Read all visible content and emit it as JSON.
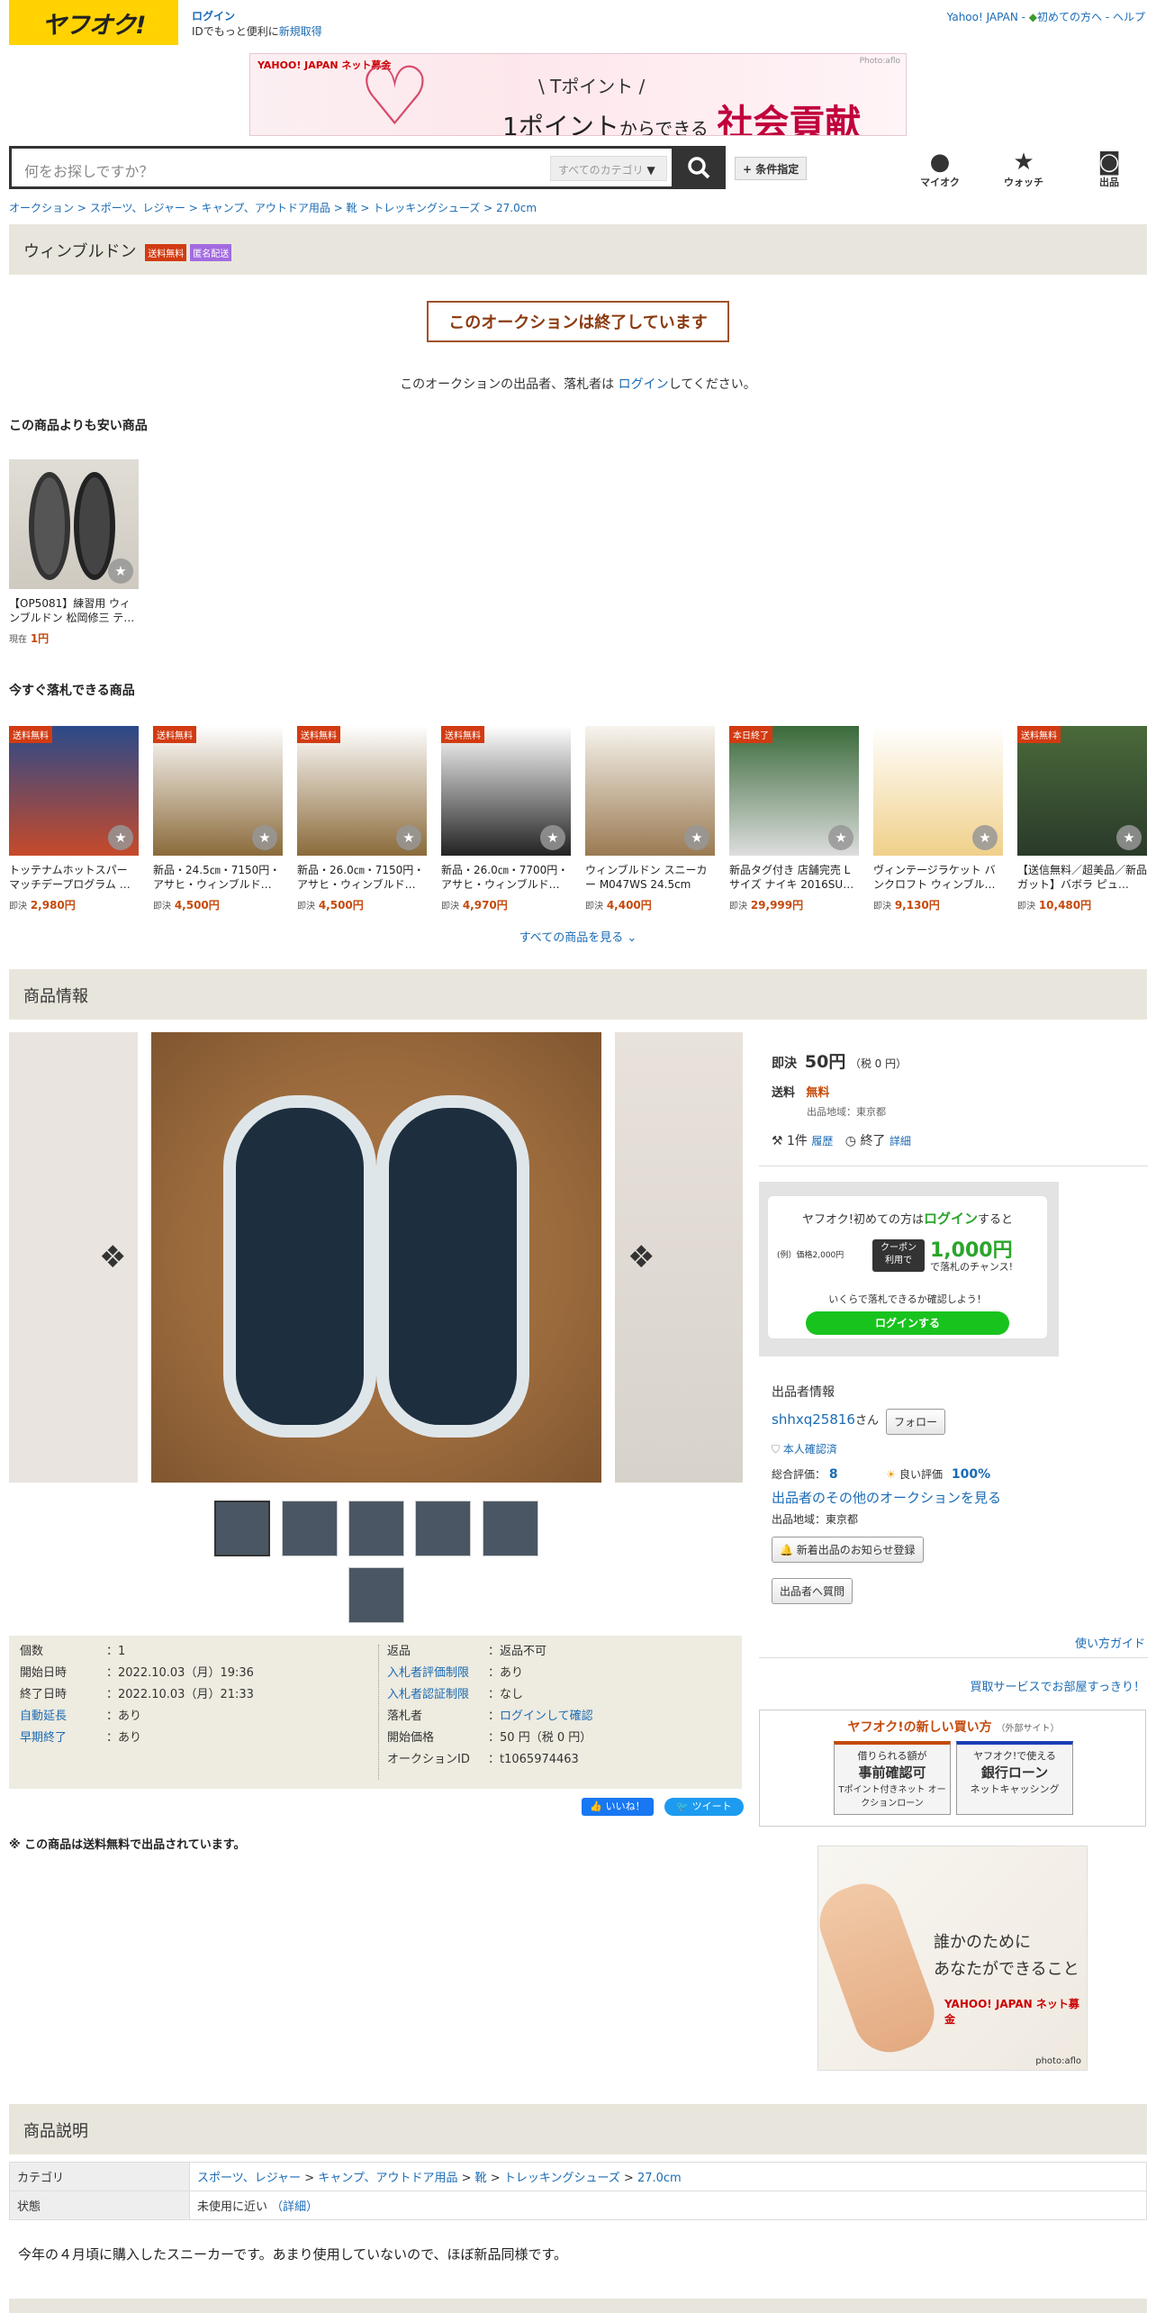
{
  "header": {
    "logo": "ヤフオク!",
    "login": "ログイン",
    "login_sub_prefix": "IDでもっと便利に",
    "register": "新規取得",
    "yahoo_japan": "Yahoo! JAPAN",
    "first_time": "初めての方へ",
    "help": "ヘルプ"
  },
  "banner": {
    "brand": "YAHOO! JAPAN ネット募金",
    "photo": "Photo:aflo",
    "line1": "\\ Tポイント /",
    "line2_a": "1ポイント",
    "line2_b": "からできる",
    "line2_c": "社会貢献"
  },
  "search": {
    "placeholder": "何をお探しですか？",
    "category": "すべてのカテゴリ",
    "conditions": "+ 条件指定"
  },
  "header_icons": {
    "myauc": "マイオク",
    "watch": "ウォッチ",
    "sell": "出品"
  },
  "breadcrumb": [
    "オークション",
    "スポーツ、レジャー",
    "キャンプ、アウトドア用品",
    "靴",
    "トレッキングシューズ",
    "27.0cm"
  ],
  "title": {
    "name": "ウィンブルドン",
    "badge1": "送料無料",
    "badge2": "匿名配送",
    "badge1_color": "#d23b12",
    "badge2_color": "#a36be0"
  },
  "ended": {
    "text": "このオークションは終了しています",
    "note_prefix": "このオークションの出品者、落札者は",
    "note_link": "ログイン",
    "note_suffix": "してください。"
  },
  "cheaper": {
    "heading": "この商品よりも安い商品",
    "items": [
      {
        "title": "【OP5081】練習用 ウィンブルドン 松岡修三 テ…",
        "price_label": "現在",
        "price": "1円"
      }
    ]
  },
  "buynow": {
    "heading": "今すぐ落札できる商品",
    "items": [
      {
        "tag": "送料無料",
        "title": "トッテナムホットスパー マッチデープログラム …",
        "price": "2,980円"
      },
      {
        "tag": "送料無料",
        "title": "新品・24.5㎝・7150円・アサヒ・ウィンブルド…",
        "price": "4,500円"
      },
      {
        "tag": "送料無料",
        "title": "新品・26.0㎝・7150円・アサヒ・ウィンブルド…",
        "price": "4,500円"
      },
      {
        "tag": "送料無料",
        "title": "新品・26.0㎝・7700円・アサヒ・ウィンブルド…",
        "price": "4,970円"
      },
      {
        "tag": "",
        "title": "ウィンブルドン スニーカー M047WS 24.5cm ブ…",
        "price": "4,400円"
      },
      {
        "tag": "本日終了",
        "title": "新品タグ付き 店舗完売 L サイズ ナイキ 2016SU…",
        "price": "29,999円"
      },
      {
        "tag": "",
        "title": "ヴィンテージラケット バンクロフト ウィンブル…",
        "price": "9,130円"
      },
      {
        "tag": "送料無料",
        "title": "【送信無料／超美品／新品ガット】バボラ ピュ…",
        "price": "10,480円"
      }
    ],
    "price_label": "即決",
    "see_all": "すべての商品を見る"
  },
  "product_info": {
    "heading": "商品情報"
  },
  "details": {
    "left": [
      {
        "k": "個数",
        "v": "1"
      },
      {
        "k": "開始日時",
        "v": "2022.10.03（月）19:36"
      },
      {
        "k": "終了日時",
        "v": "2022.10.03（月）21:33"
      },
      {
        "k": "自動延長",
        "v": "あり"
      },
      {
        "k": "早期終了",
        "v": "あり"
      }
    ],
    "right": [
      {
        "k": "返品",
        "v": "返品不可"
      },
      {
        "k": "入札者評価制限",
        "v": "あり"
      },
      {
        "k": "入札者認証制限",
        "v": "なし"
      },
      {
        "k": "落札者",
        "v": "ログインして確認"
      },
      {
        "k": "開始価格",
        "v": "50 円（税 0 円）"
      },
      {
        "k": "オークションID",
        "v": "t1065974463"
      }
    ],
    "like": "いいね！",
    "tweet": "ツイート",
    "shipping_note": "※ この商品は送料無料で出品されています。"
  },
  "side": {
    "price_label": "即決",
    "price": "50円",
    "tax": "（税 0 円）",
    "shipping_label": "送料",
    "shipping": "無料",
    "region": "出品地域：東京都",
    "bids": "1件",
    "history": "履歴",
    "end": "終了",
    "detail": "詳細",
    "login_promo": {
      "l1a": "ヤフオク!初めての方は",
      "l1b": "ログイン",
      "l1c": "すると",
      "ex": "(例）価格2,000円",
      "coupon": "クーポン 利用で",
      "amount": "1,000円",
      "chance": "で落札のチャンス!",
      "check": "いくらで落札できるか確認しよう！",
      "btn": "ログインする"
    },
    "seller": {
      "heading": "出品者情報",
      "name": "shhxq25816",
      "san": "さん",
      "follow": "フォロー",
      "verified": "本人確認済",
      "rating_label": "総合評価：",
      "rating": "8",
      "good_label": "良い評価",
      "good": "100%",
      "other": "出品者のその他のオークションを見る",
      "region": "出品地域：東京都",
      "notify": "新着出品のお知らせ登録",
      "question": "出品者へ質問"
    },
    "guide": "使い方ガイド",
    "buyback": "買取サービスでお部屋すっきり！",
    "new_buy": {
      "title": "ヤフオク!の新しい買い方",
      "ext": "（外部サイト）",
      "c1a": "借りられる額が",
      "c1b": "事前確認可",
      "c1c": "Tポイント付きネット オークションローン",
      "c2a": "ヤフオク!で使える",
      "c2b": "銀行ローン",
      "c2c": "ネットキャッシング"
    },
    "ad": {
      "l1": "誰かのために",
      "l2": "あなたができること",
      "brand": "YAHOO! JAPAN ネット募金",
      "photo": "photo:aflo"
    }
  },
  "description": {
    "heading": "商品説明",
    "category_label": "カテゴリ",
    "category": [
      "スポーツ、レジャー",
      "キャンプ、アウトドア用品",
      "靴",
      "トレッキングシューズ",
      "27.0cm"
    ],
    "condition_label": "状態",
    "condition": "未使用に近い",
    "condition_detail": "（詳細）",
    "text": "今年の４月頃に購入したスニーカーです。あまり使用していないので、ほぼ新品同様です。"
  }
}
